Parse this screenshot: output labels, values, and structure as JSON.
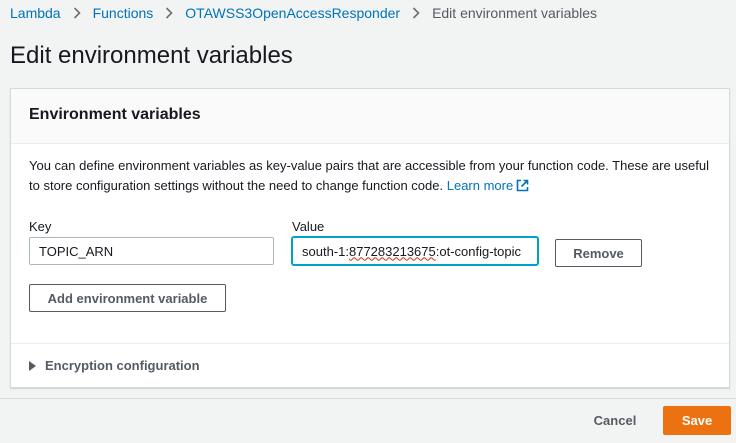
{
  "breadcrumb": {
    "items": [
      "Lambda",
      "Functions",
      "OTAWSS3OpenAccessResponder"
    ],
    "current": "Edit environment variables"
  },
  "page": {
    "title": "Edit environment variables"
  },
  "env_panel": {
    "title": "Environment variables",
    "description": "You can define environment variables as key-value pairs that are accessible from your function code. These are useful to store configuration settings without the need to change function code.",
    "learn_more": "Learn more",
    "key_label": "Key",
    "value_label": "Value",
    "rows": [
      {
        "key": "TOPIC_ARN",
        "value_prefix": "south-1:",
        "value_misspelled": "877283213675",
        "value_suffix": ":ot-config-topic",
        "remove_label": "Remove"
      }
    ],
    "add_label": "Add environment variable",
    "encryption_label": "Encryption configuration"
  },
  "footer": {
    "cancel_label": "Cancel",
    "save_label": "Save"
  },
  "colors": {
    "link": "#0073bb",
    "primary": "#ec7211",
    "focus": "#00a1c9"
  }
}
